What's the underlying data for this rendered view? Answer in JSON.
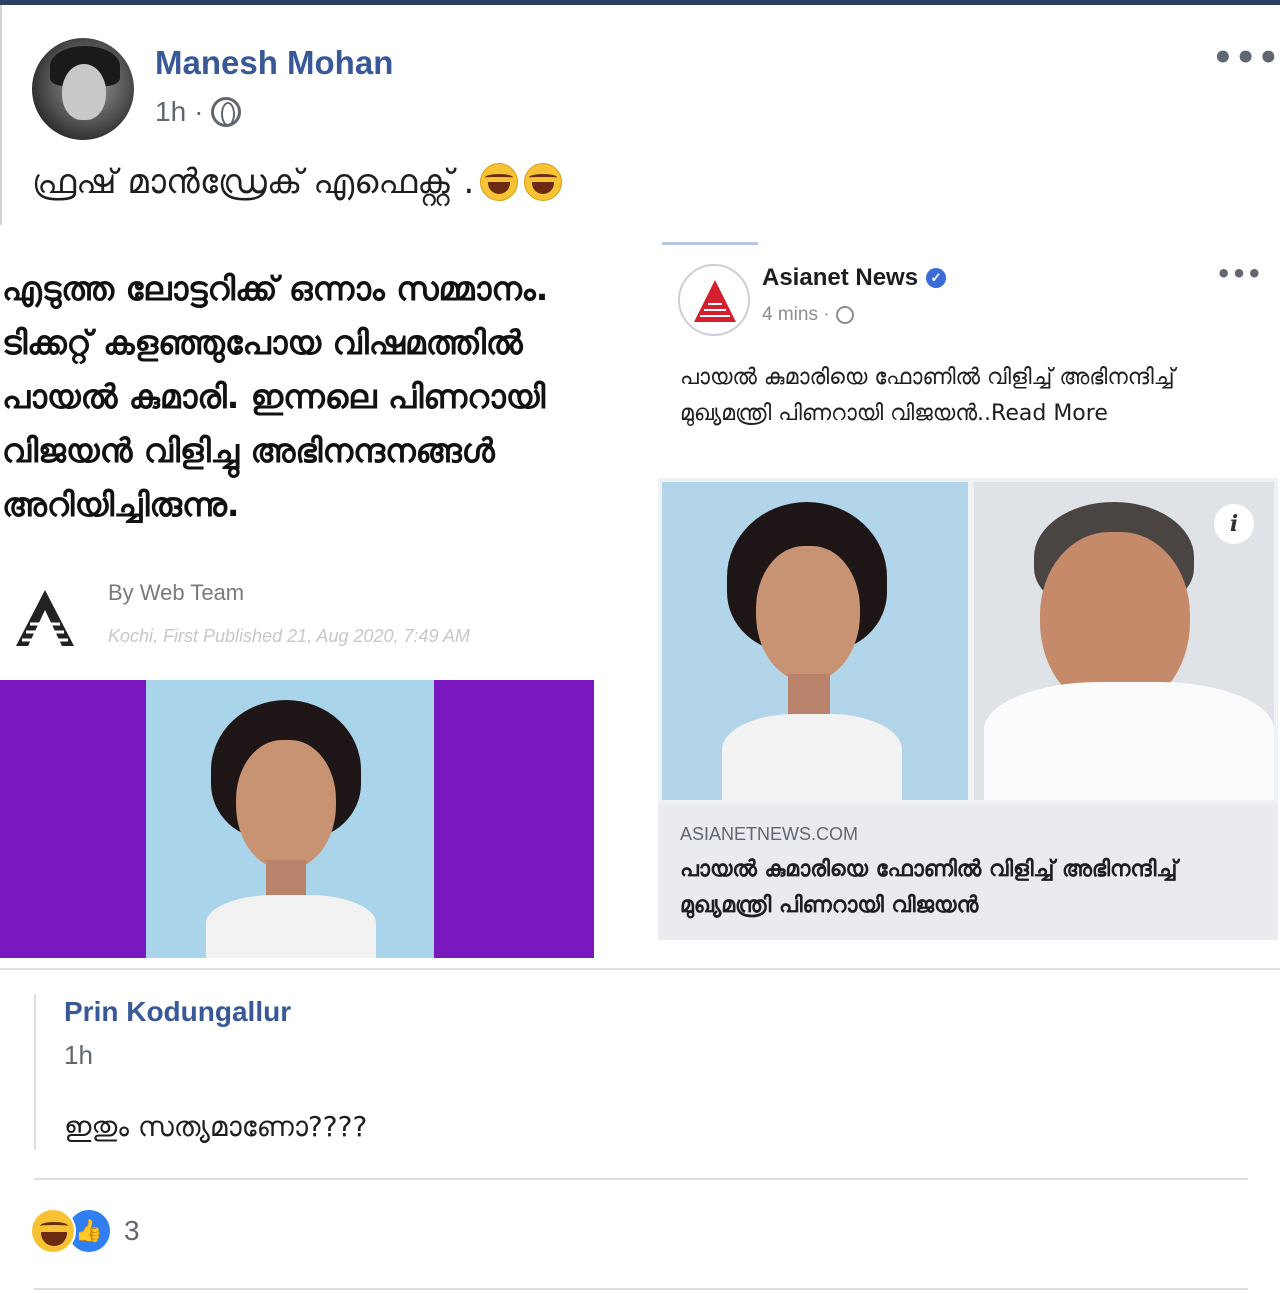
{
  "post": {
    "author": "Manesh Mohan",
    "time": "1h",
    "time_separator": "·",
    "privacy_icon": "globe-icon",
    "more_label": "•••",
    "text": "ഫ്രഷ് മാൻഡ്രേക് എഫെക്റ്റ് ."
  },
  "news_left": {
    "headline": "എടുത്ത ലോട്ടറിക്ക് ഒന്നാം സമ്മാനം. ടിക്കറ്റ് കളഞ്ഞുപോയ വിഷമത്തിൽ പായൽ കുമാരി. ഇന്നലെ പിണറായി വിജയൻ വിളിച്ചു  അഭിനന്ദനങ്ങൾ അറിയിച്ചിരുന്നു.",
    "byline": "By Web Team",
    "dateline": "Kochi, First Published 21, Aug 2020, 7:49 AM"
  },
  "fb_card": {
    "page_name": "Asianet News",
    "verified_mark": "✓",
    "time": "4 mins ·",
    "more_label": "•••",
    "text": "പായൽ കുമാരിയെ ഫോണിൽ വിളിച്ച് അഭിനന്ദിച്ച് മുഖ്യമന്ത്രി പിണറായി വിജയൻ..Read More",
    "info_label": "i",
    "domain": "ASIANETNEWS.COM",
    "link_title": "പായൽ കുമാരിയെ ഫോണിൽ വിളിച്ച് അഭിനന്ദിച്ച് മുഖ്യമന്ത്രി പിണറായി വിജയൻ"
  },
  "comment": {
    "author": "Prin Kodungallur",
    "time": "1h",
    "text": "ഇതും സത്യമാണോ????"
  },
  "reactions": {
    "icons": [
      "haha-icon",
      "like-icon"
    ],
    "like_glyph": "👍",
    "count": "3"
  },
  "colors": {
    "link_blue": "#385898",
    "purple_bg": "#7a18c0",
    "photo_blue": "#a9d4ea",
    "top_bar": "#2d3f63"
  }
}
